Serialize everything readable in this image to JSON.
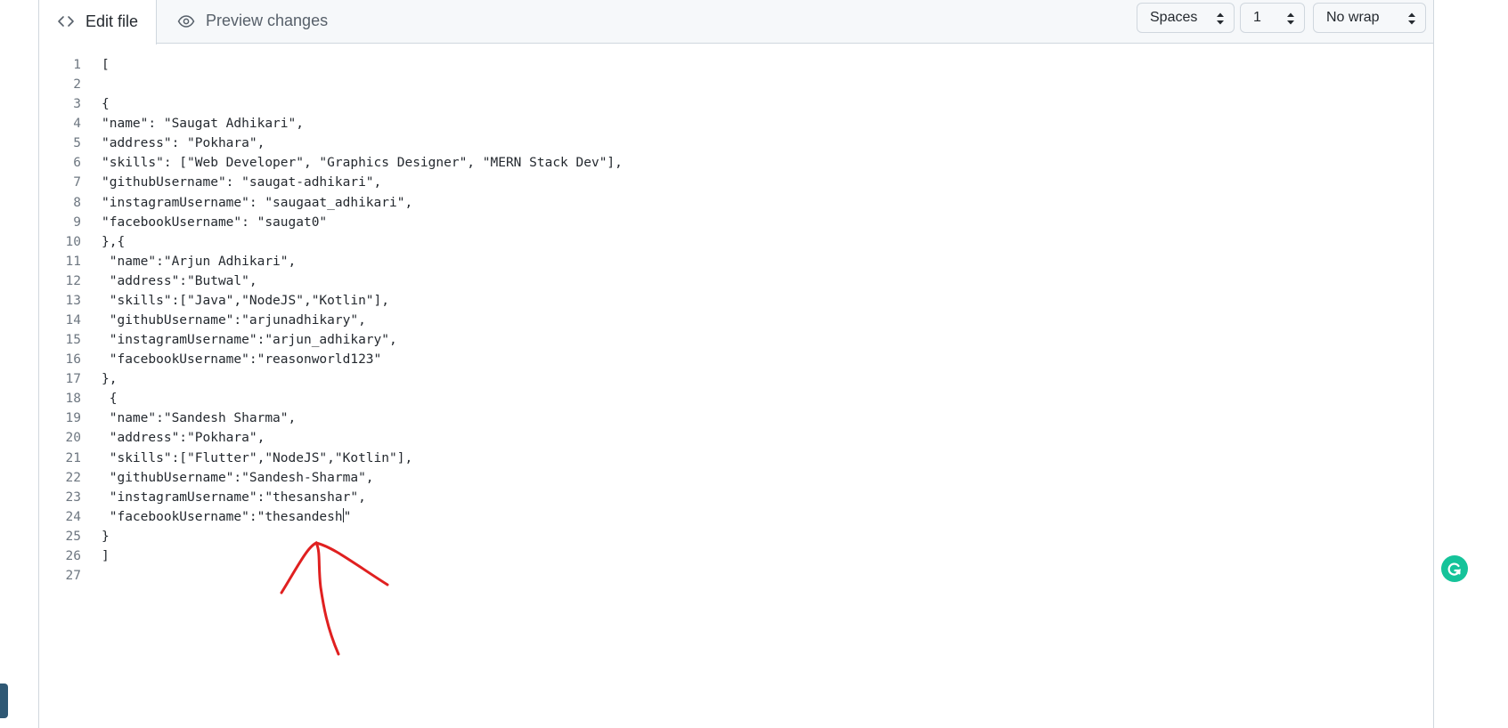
{
  "toolbar": {
    "tabs": [
      {
        "label": "Edit file",
        "icon": "code-icon",
        "active": true
      },
      {
        "label": "Preview changes",
        "icon": "eye-icon",
        "active": false
      }
    ],
    "indent_mode": "Spaces",
    "indent_size": "1",
    "wrap_mode": "No wrap"
  },
  "editor": {
    "lines": [
      {
        "n": "1",
        "text": "["
      },
      {
        "n": "2",
        "text": ""
      },
      {
        "n": "3",
        "text": "{"
      },
      {
        "n": "4",
        "text": "\"name\": \"Saugat Adhikari\","
      },
      {
        "n": "5",
        "text": "\"address\": \"Pokhara\","
      },
      {
        "n": "6",
        "text": "\"skills\": [\"Web Developer\", \"Graphics Designer\", \"MERN Stack Dev\"],"
      },
      {
        "n": "7",
        "text": "\"githubUsername\": \"saugat-adhikari\","
      },
      {
        "n": "8",
        "text": "\"instagramUsername\": \"saugaat_adhikari\","
      },
      {
        "n": "9",
        "text": "\"facebookUsername\": \"saugat0\""
      },
      {
        "n": "10",
        "text": "},{"
      },
      {
        "n": "11",
        "text": " \"name\":\"Arjun Adhikari\","
      },
      {
        "n": "12",
        "text": " \"address\":\"Butwal\","
      },
      {
        "n": "13",
        "text": " \"skills\":[\"Java\",\"NodeJS\",\"Kotlin\"],"
      },
      {
        "n": "14",
        "text": " \"githubUsername\":\"arjunadhikary\","
      },
      {
        "n": "15",
        "text": " \"instagramUsername\":\"arjun_adhikary\","
      },
      {
        "n": "16",
        "text": " \"facebookUsername\":\"reasonworld123\""
      },
      {
        "n": "17",
        "text": "},"
      },
      {
        "n": "18",
        "text": " {"
      },
      {
        "n": "19",
        "text": " \"name\":\"Sandesh Sharma\","
      },
      {
        "n": "20",
        "text": " \"address\":\"Pokhara\","
      },
      {
        "n": "21",
        "text": " \"skills\":[\"Flutter\",\"NodeJS\",\"Kotlin\"],"
      },
      {
        "n": "22",
        "text": " \"githubUsername\":\"Sandesh-Sharma\","
      },
      {
        "n": "23",
        "text": " \"instagramUsername\":\"thesanshar\","
      },
      {
        "n": "24",
        "text": " \"facebookUsername\":\"thesandesh\"",
        "cursor_after": " \"facebookUsername\":\"thesandesh"
      },
      {
        "n": "25",
        "text": "}"
      },
      {
        "n": "26",
        "text": "]"
      },
      {
        "n": "27",
        "text": ""
      }
    ]
  },
  "colors": {
    "annotation_arrow": "#e02020",
    "grammarly": "#15c39a"
  },
  "icons": [
    "code-icon",
    "eye-icon",
    "select-arrows-icon",
    "grammarly-icon",
    "annotation-arrow"
  ]
}
